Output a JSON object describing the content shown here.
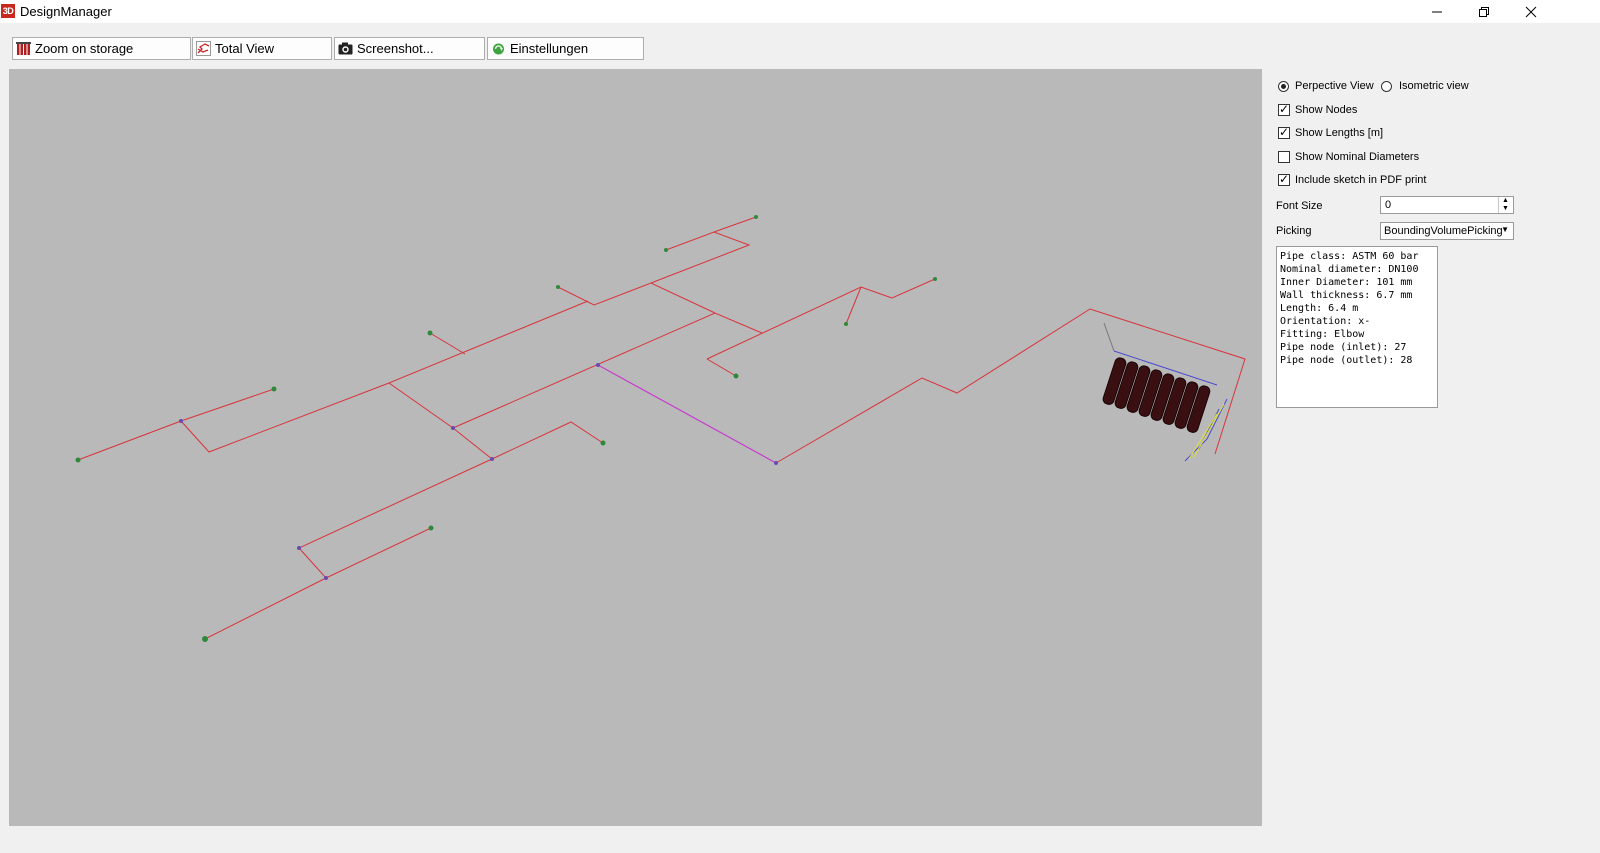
{
  "window": {
    "app_icon": "3D",
    "title": "DesignManager"
  },
  "toolbar": {
    "zoom_storage": "Zoom on storage",
    "total_view": "Total View",
    "screenshot": "Screenshot...",
    "settings": "Einstellungen"
  },
  "icons": {
    "zoom_storage": "storage-cylinders-icon",
    "total_view": "total-view-icon",
    "screenshot": "camera-icon",
    "settings": "refresh-arrow-icon"
  },
  "view_mode": {
    "perspective_label": "Perpective View",
    "isometric_label": "Isometric view",
    "selected": "perspective"
  },
  "options": {
    "show_nodes": {
      "label": "Show Nodes",
      "checked": true
    },
    "show_lengths": {
      "label": "Show Lengths [m]",
      "checked": true
    },
    "show_nominal": {
      "label": "Show Nominal Diameters",
      "checked": false
    },
    "include_pdf": {
      "label": "Include sketch in PDF print",
      "checked": true
    }
  },
  "font_size": {
    "label": "Font Size",
    "value": "0"
  },
  "picking": {
    "label": "Picking",
    "value": "BoundingVolumePicking"
  },
  "info": {
    "lines": [
      "Pipe class: ASTM 60 bar",
      "Nominal diameter: DN100",
      "Inner Diameter: 101 mm",
      "Wall thickness: 6.7 mm",
      "Length: 6.4 m",
      "Orientation: x-",
      "Fitting: Elbow",
      "Pipe node (inlet): 27",
      "Pipe node (outlet): 28"
    ]
  },
  "colors": {
    "viewport_bg": "#b9b9b9",
    "pipe": "#d8343c",
    "selected_pipe": "#c83ccf",
    "node_end": "#2e8a3a",
    "node": "#6a4ab0",
    "cylinder": "#3a0f12"
  }
}
